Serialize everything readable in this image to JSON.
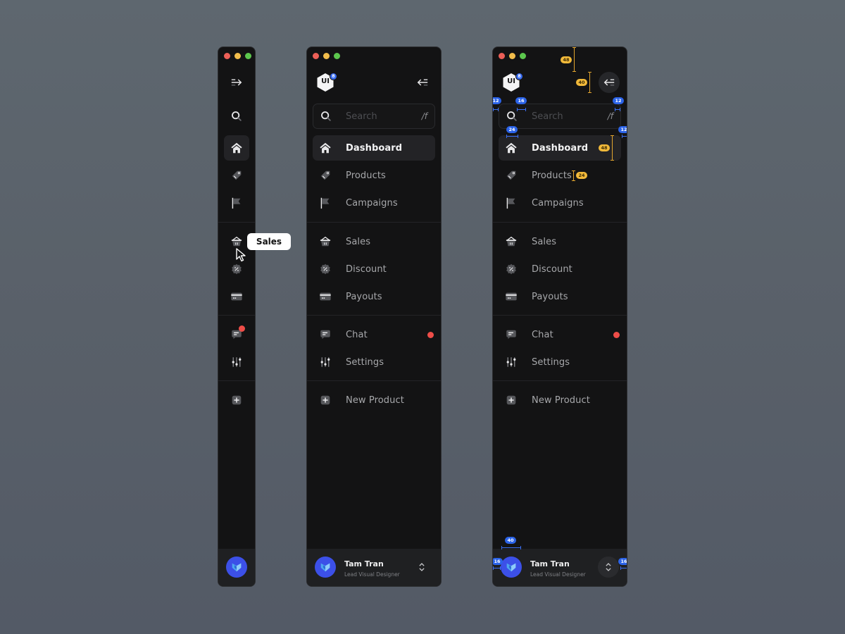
{
  "brand": {
    "logo_text": "UI",
    "logo_badge": "8"
  },
  "search": {
    "placeholder": "Search",
    "shortcut": "/f"
  },
  "nav": {
    "group1": [
      {
        "label": "Dashboard",
        "icon": "home-icon",
        "active": true
      },
      {
        "label": "Products",
        "icon": "tag-icon"
      },
      {
        "label": "Campaigns",
        "icon": "flag-icon"
      }
    ],
    "group2": [
      {
        "label": "Sales",
        "icon": "basket-icon"
      },
      {
        "label": "Discount",
        "icon": "discount-badge-icon"
      },
      {
        "label": "Payouts",
        "icon": "credit-card-icon"
      }
    ],
    "group3": [
      {
        "label": "Chat",
        "icon": "chat-icon",
        "notification": true
      },
      {
        "label": "Settings",
        "icon": "sliders-icon"
      }
    ],
    "group4": [
      {
        "label": "New Product",
        "icon": "plus-square-icon"
      }
    ]
  },
  "tooltip": {
    "text": "Sales"
  },
  "user": {
    "name": "Tam Tran",
    "role": "Lead Visual Designer"
  },
  "annotations": {
    "header_height": "48",
    "button_size": "40",
    "panel_padding": "12",
    "search_icon_gap": "16",
    "search_right_padding": "12",
    "item_icon_width": "24",
    "item_right_padding": "12",
    "item_height": "48",
    "item_gap": "24",
    "avatar_size": "40",
    "footer_left_padding": "16",
    "footer_right_padding": "16"
  },
  "colors": {
    "accent_blue": "#3c50e8",
    "notification_red": "#ee4d48",
    "annotation_yellow": "#f1b93a",
    "annotation_blue": "#2b63e8"
  }
}
